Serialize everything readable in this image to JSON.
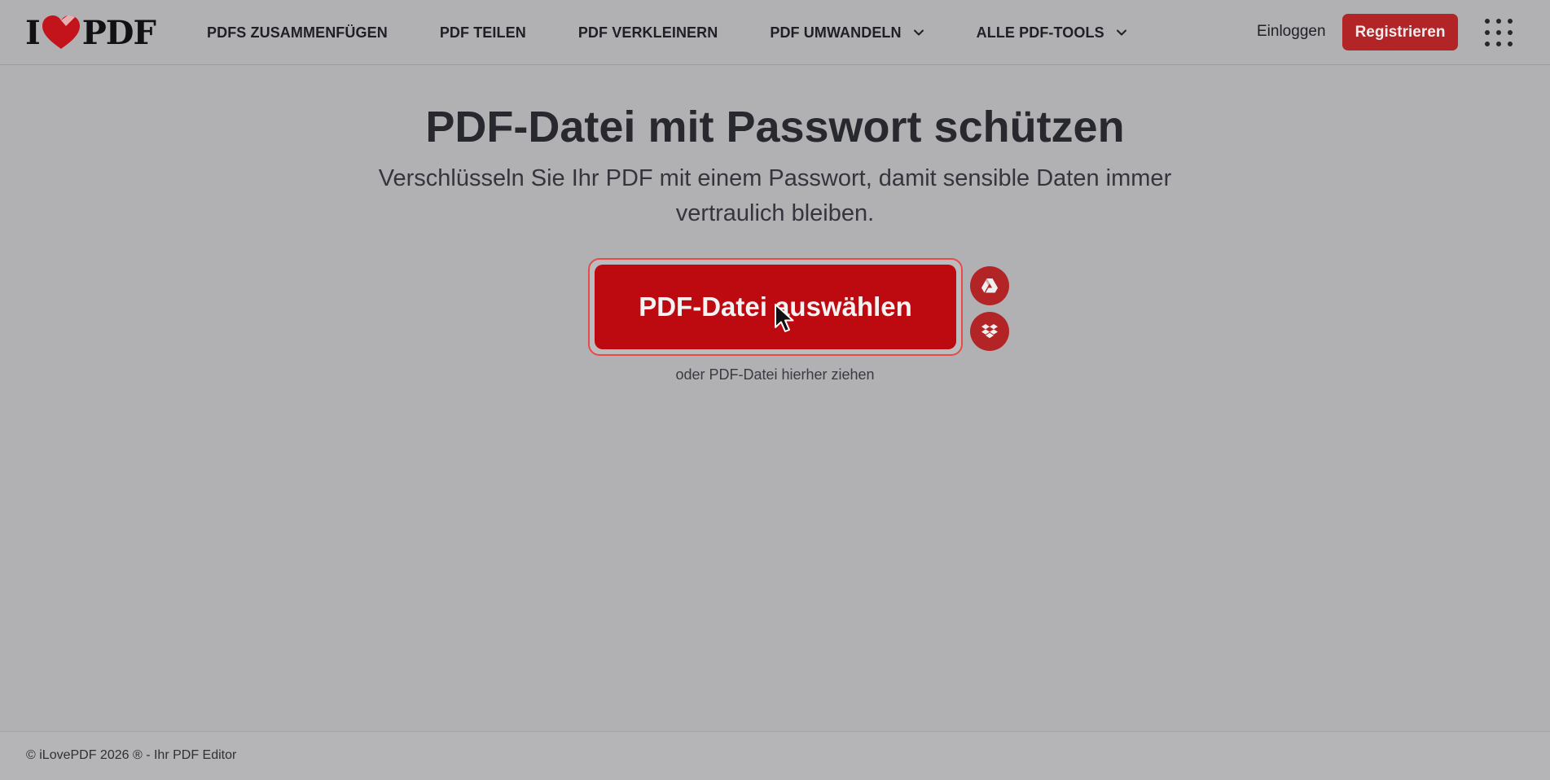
{
  "header": {
    "logo": {
      "left": "I",
      "right": "PDF"
    },
    "nav": [
      {
        "label": "PDFS ZUSAMMENFÜGEN",
        "dropdown": false
      },
      {
        "label": "PDF TEILEN",
        "dropdown": false
      },
      {
        "label": "PDF VERKLEINERN",
        "dropdown": false
      },
      {
        "label": "PDF UMWANDELN",
        "dropdown": true
      },
      {
        "label": "ALLE PDF-TOOLS",
        "dropdown": true
      }
    ],
    "login_label": "Einloggen",
    "register_label": "Registrieren"
  },
  "main": {
    "title": "PDF-Datei mit Passwort schützen",
    "subtitle": "Verschlüsseln Sie Ihr PDF mit einem Passwort, damit sensible Daten immer vertraulich bleiben.",
    "upload_label": "PDF-Datei auswählen",
    "drop_hint": "oder PDF-Datei hierher ziehen"
  },
  "footer": {
    "text": "© iLovePDF 2026 ® - Ihr PDF Editor"
  },
  "colors": {
    "background": "#b1b1b3",
    "brand_red": "#bd0a10",
    "button_red": "#b32426",
    "highlight_border": "#e84a4a",
    "text_dark": "#28282f"
  },
  "icons": {
    "logo_heart": "heart-icon",
    "gdrive": "google-drive-icon",
    "dropbox": "dropbox-icon",
    "apps": "apps-grid-icon",
    "chevron": "chevron-down-icon",
    "cursor": "mouse-pointer-icon"
  }
}
